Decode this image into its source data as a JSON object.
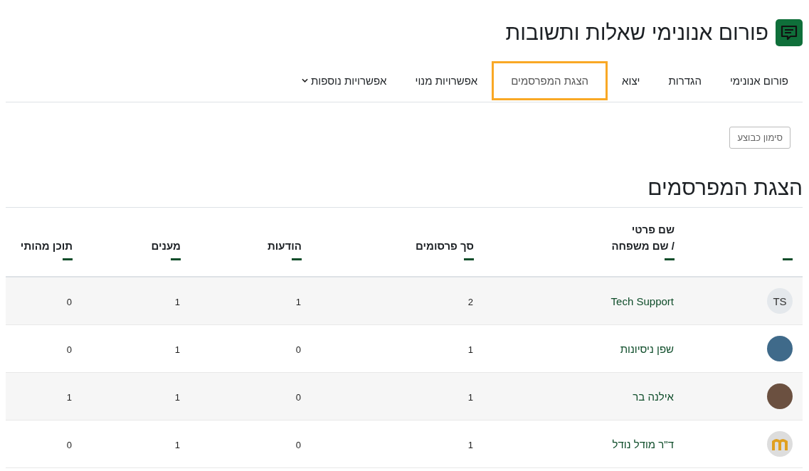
{
  "page": {
    "title": "פורום אנונימי שאלות ותשובות"
  },
  "tabs": [
    {
      "label": "פורום אנונימי",
      "selected": false
    },
    {
      "label": "הגדרות",
      "selected": false
    },
    {
      "label": "יצוא",
      "selected": false
    },
    {
      "label": "הצגת המפרסמים",
      "selected": true
    },
    {
      "label": "אפשרויות מנוי",
      "selected": false
    },
    {
      "label": "אפשרויות נוספות",
      "selected": false,
      "dropdown": true
    }
  ],
  "mark_done_button": "סימון כבוצע",
  "section_heading": "הצגת המפרסמים",
  "table": {
    "columns": [
      {
        "sortable": true
      },
      {
        "lines": [
          "שם פרטי",
          "/ שם משפחה"
        ]
      },
      {
        "label": "סך פרסומים"
      },
      {
        "label": "הודעות"
      },
      {
        "label": "מענים"
      },
      {
        "label": "תוכן מהותי"
      }
    ],
    "rows": [
      {
        "avatar": {
          "kind": "initials",
          "text": "TS"
        },
        "name": "Tech Support",
        "total_posts": "2",
        "discussions": "1",
        "replies": "1",
        "substantive": "0"
      },
      {
        "avatar": {
          "kind": "photo",
          "color": "#3f6a8a"
        },
        "name": "שפן ניסיונות",
        "total_posts": "1",
        "discussions": "0",
        "replies": "1",
        "substantive": "0"
      },
      {
        "avatar": {
          "kind": "photo",
          "color": "#6b5040"
        },
        "name": "אילנה בר",
        "total_posts": "1",
        "discussions": "0",
        "replies": "1",
        "substantive": "1"
      },
      {
        "avatar": {
          "kind": "logo",
          "color": "#e0a020"
        },
        "name": "ד\"ר מודל נודל",
        "total_posts": "1",
        "discussions": "0",
        "replies": "1",
        "substantive": "0"
      }
    ]
  }
}
